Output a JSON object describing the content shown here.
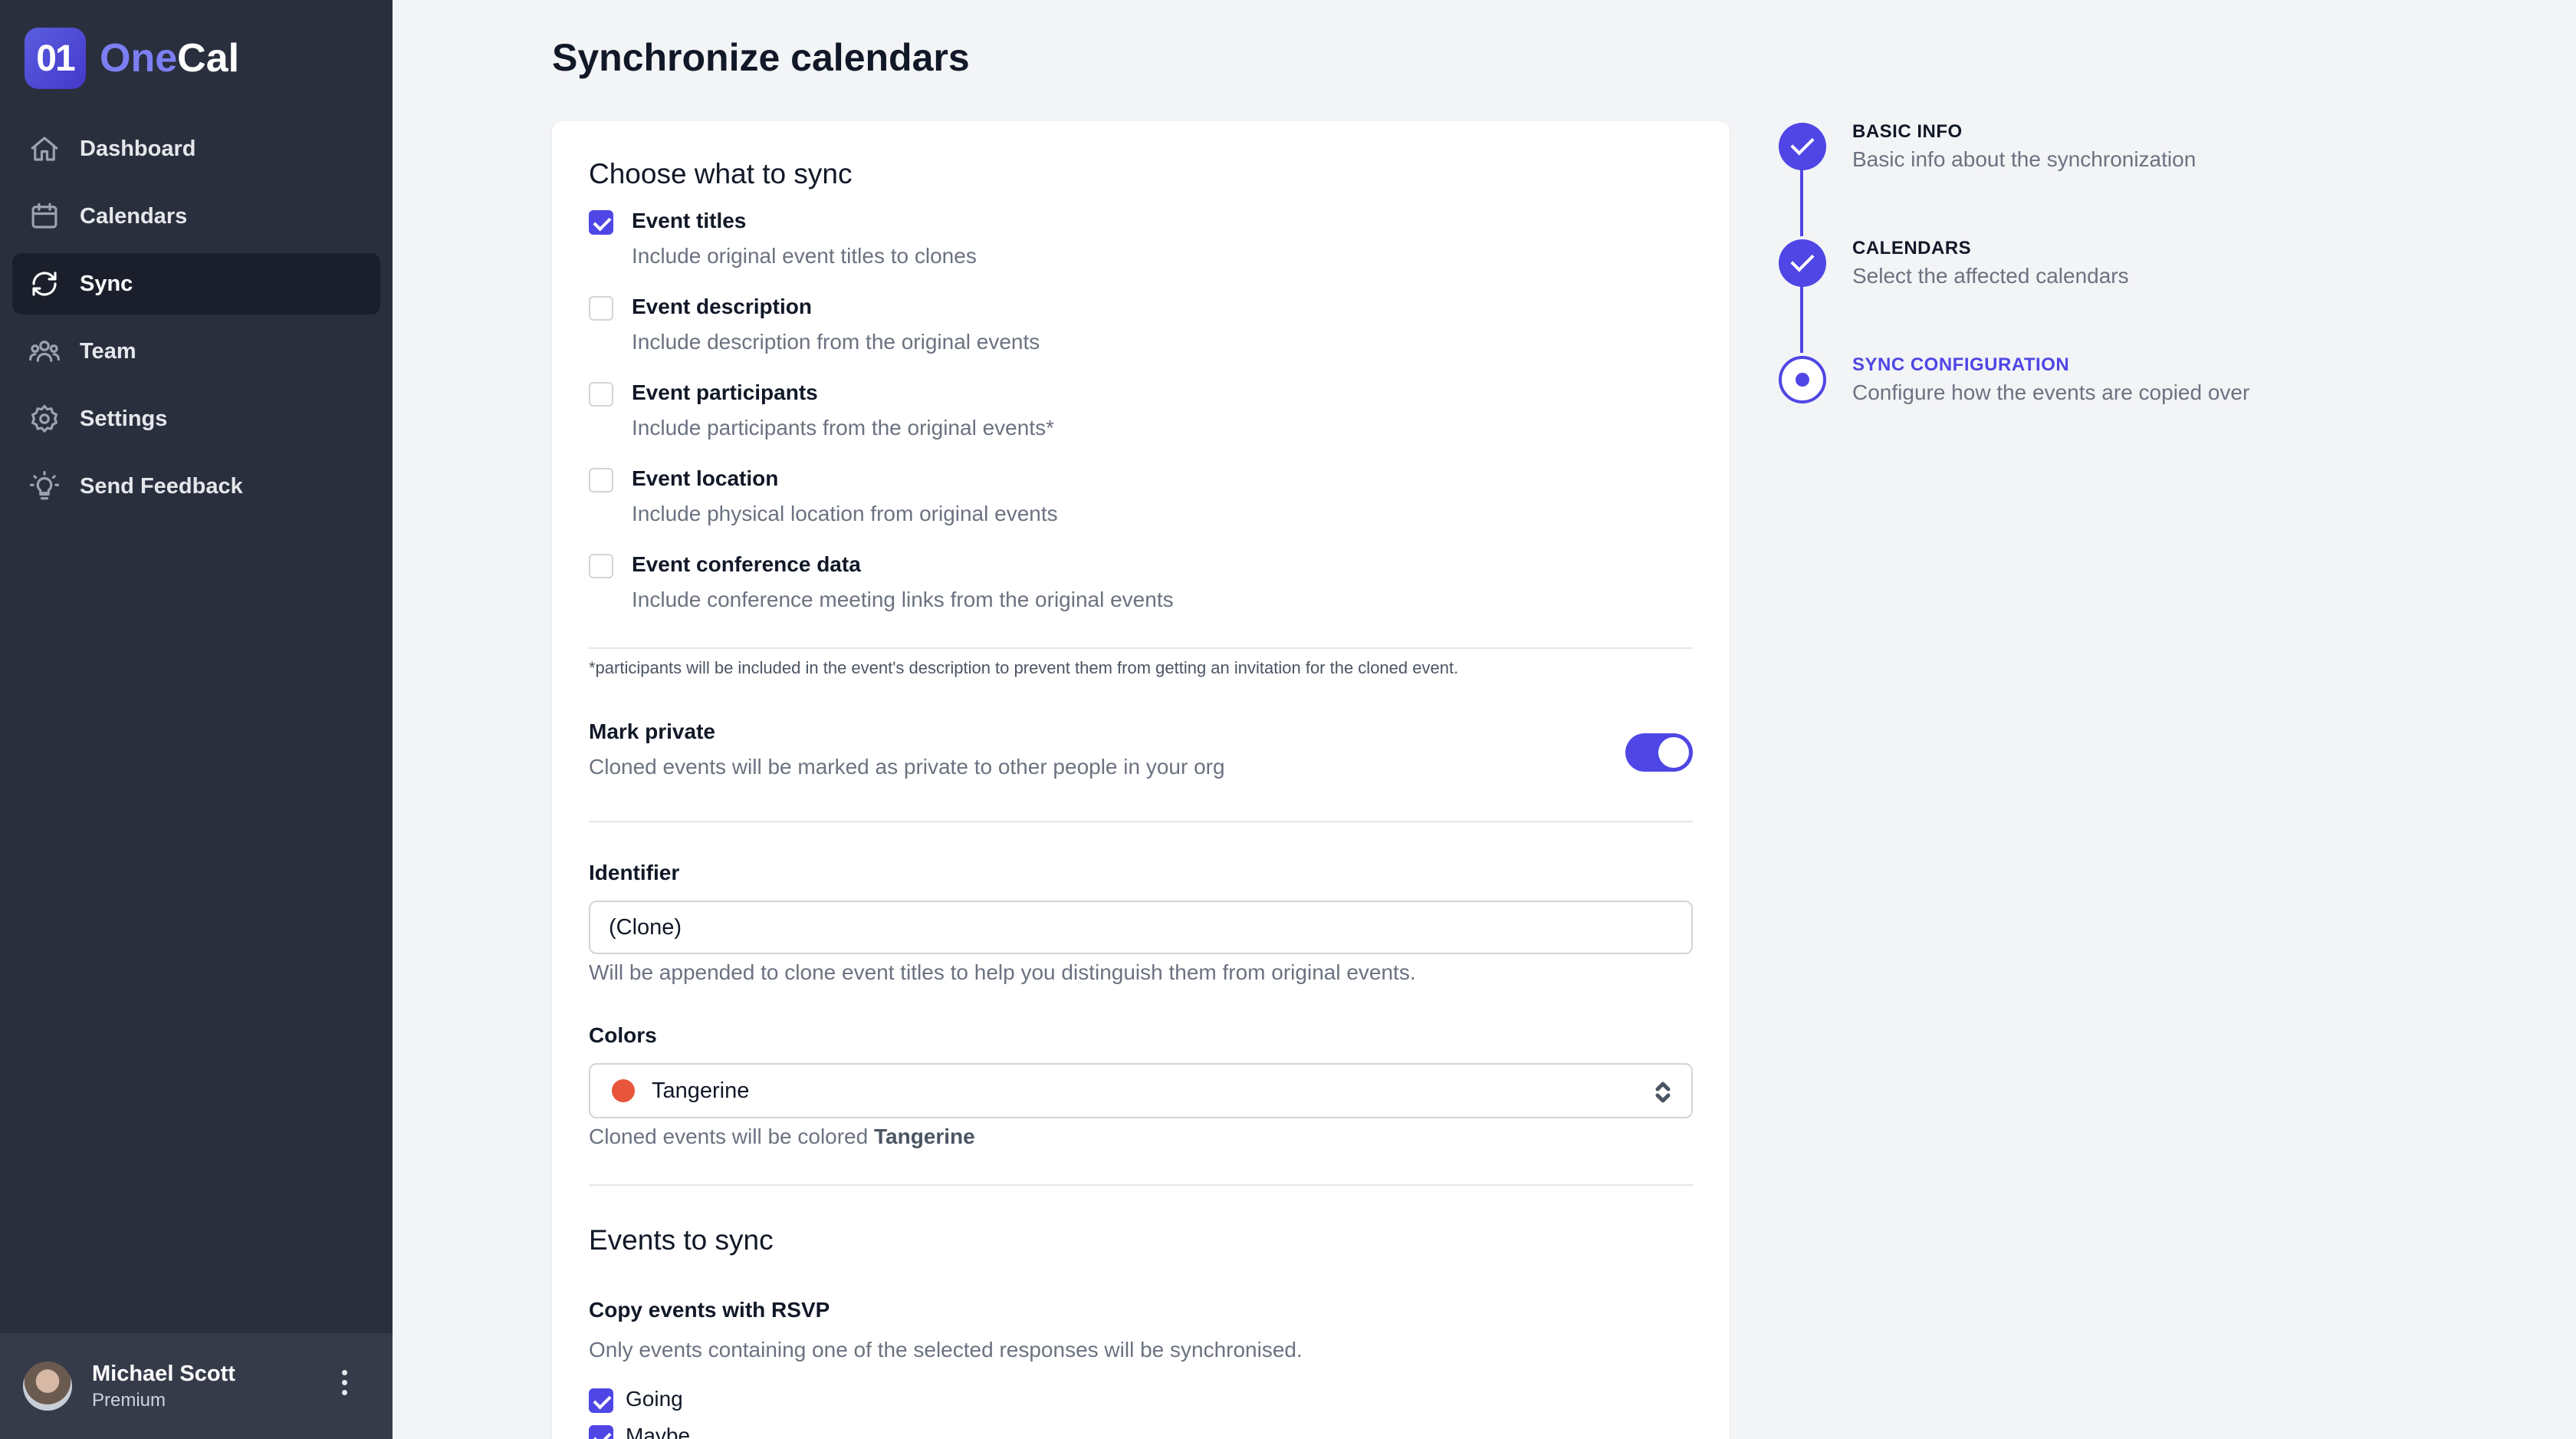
{
  "app": {
    "logo_mark": "01",
    "logo_one": "One",
    "logo_cal": "Cal"
  },
  "sidebar": {
    "items": [
      {
        "label": "Dashboard",
        "icon": "home-icon"
      },
      {
        "label": "Calendars",
        "icon": "calendar-icon"
      },
      {
        "label": "Sync",
        "icon": "sync-icon",
        "active": true
      },
      {
        "label": "Team",
        "icon": "team-icon"
      },
      {
        "label": "Settings",
        "icon": "gear-icon"
      },
      {
        "label": "Send Feedback",
        "icon": "lightbulb-icon"
      }
    ],
    "user": {
      "name": "Michael Scott",
      "plan": "Premium"
    }
  },
  "page": {
    "title": "Synchronize calendars"
  },
  "sync_form": {
    "choose_title": "Choose what to sync",
    "options": [
      {
        "label": "Event titles",
        "desc": "Include original event titles to clones",
        "checked": true
      },
      {
        "label": "Event description",
        "desc": "Include description from the original events",
        "checked": false
      },
      {
        "label": "Event participants",
        "desc": "Include participants from the original events*",
        "checked": false
      },
      {
        "label": "Event location",
        "desc": "Include physical location from original events",
        "checked": false
      },
      {
        "label": "Event conference data",
        "desc": "Include conference meeting links from the original events",
        "checked": false
      }
    ],
    "footnote": "*participants will be included in the event's description to prevent them from getting an invitation for the cloned event.",
    "mark_private": {
      "label": "Mark private",
      "desc": "Cloned events will be marked as private to other people in your org",
      "enabled": true
    },
    "identifier": {
      "label": "Identifier",
      "value": "(Clone)",
      "help": "Will be appended to clone event titles to help you distinguish them from original events."
    },
    "colors": {
      "label": "Colors",
      "selected": "Tangerine",
      "swatch": "#e8553a",
      "help_prefix": "Cloned events will be colored",
      "help_value": "Tangerine"
    },
    "events_title": "Events to sync",
    "rsvp": {
      "label": "Copy events with RSVP",
      "help": "Only events containing one of the selected responses will be synchronised.",
      "options": [
        {
          "label": "Going",
          "checked": true
        },
        {
          "label": "Maybe",
          "checked": true
        }
      ]
    }
  },
  "steps": [
    {
      "title": "BASIC INFO",
      "desc": "Basic info about the synchronization",
      "state": "done"
    },
    {
      "title": "CALENDARS",
      "desc": "Select the affected calendars",
      "state": "done"
    },
    {
      "title": "SYNC CONFIGURATION",
      "desc": "Configure how the events are copied over",
      "state": "current"
    }
  ],
  "colors": {
    "accent": "#4f46e5",
    "sidebar_bg": "#2a2f3e",
    "page_bg": "#f3f4f6"
  }
}
